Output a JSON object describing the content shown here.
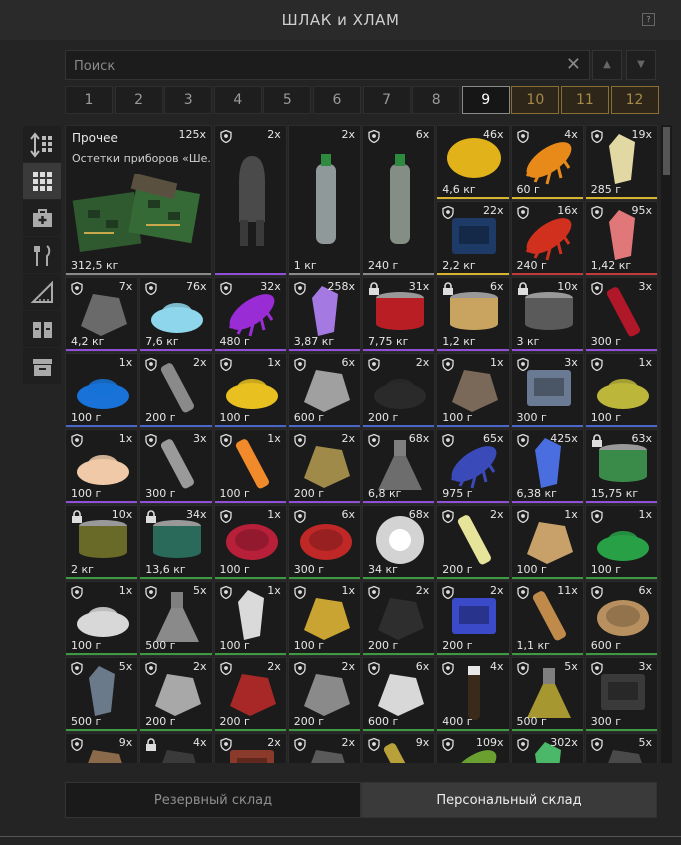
{
  "window": {
    "title": "ШЛАК и ХЛАМ",
    "help": "?"
  },
  "search": {
    "placeholder": "Поиск",
    "value": ""
  },
  "pages": [
    {
      "label": "1",
      "state": "normal"
    },
    {
      "label": "2",
      "state": "normal"
    },
    {
      "label": "3",
      "state": "normal"
    },
    {
      "label": "4",
      "state": "normal"
    },
    {
      "label": "5",
      "state": "normal"
    },
    {
      "label": "6",
      "state": "normal"
    },
    {
      "label": "7",
      "state": "normal"
    },
    {
      "label": "8",
      "state": "normal"
    },
    {
      "label": "9",
      "state": "active"
    },
    {
      "label": "10",
      "state": "locked"
    },
    {
      "label": "11",
      "state": "locked"
    },
    {
      "label": "12",
      "state": "locked"
    }
  ],
  "sidebar": [
    {
      "icon": "sort-icon",
      "active": false
    },
    {
      "icon": "grid-icon",
      "active": true
    },
    {
      "icon": "medkit-icon",
      "active": false
    },
    {
      "icon": "cutlery-icon",
      "active": false
    },
    {
      "icon": "ruler-icon",
      "active": false
    },
    {
      "icon": "book-icon",
      "active": false
    },
    {
      "icon": "archive-icon",
      "active": false
    }
  ],
  "featured": {
    "name": "Прочее",
    "desc": "Остетки приборов «Ше...",
    "count": "125x",
    "weight": "312,5 кг"
  },
  "colors": {
    "grey": "#8a8a8a",
    "blue": "#4a66c8",
    "purple": "#8f4fd8",
    "red": "#c23a3a",
    "yellow": "#d8b530",
    "green": "#3d9a40",
    "none": "#2c2c2c"
  },
  "items": [
    {
      "r": 0,
      "c": 2,
      "rs": 2,
      "cnt": "2x",
      "wt": "",
      "sh": "shield",
      "bar": "purple",
      "icon": "bomb-icon",
      "col": "#4a4a4a"
    },
    {
      "r": 0,
      "c": 3,
      "rs": 2,
      "cnt": "2x",
      "wt": "1 кг",
      "sh": "",
      "bar": "grey",
      "icon": "water-bottle-icon",
      "col": "#b8c4c4"
    },
    {
      "r": 0,
      "c": 4,
      "rs": 2,
      "cnt": "6x",
      "wt": "240 г",
      "sh": "shield",
      "bar": "grey",
      "icon": "water-bottle-icon",
      "col": "#a9b6aa"
    },
    {
      "r": 0,
      "c": 5,
      "cnt": "46x",
      "wt": "4,6 кг",
      "sh": "",
      "bar": "yellow",
      "icon": "lemon-icon",
      "col": "#e1b21a"
    },
    {
      "r": 0,
      "c": 6,
      "cnt": "4x",
      "wt": "60 г",
      "sh": "shield",
      "bar": "yellow",
      "icon": "spiky-orange-icon",
      "col": "#e88a1a"
    },
    {
      "r": 0,
      "c": 7,
      "cnt": "19x",
      "wt": "285 г",
      "sh": "shield",
      "bar": "yellow",
      "icon": "pale-crystal-icon",
      "col": "#e2d8a4"
    },
    {
      "r": 1,
      "c": 5,
      "cnt": "22x",
      "wt": "2,2 кг",
      "sh": "shield",
      "bar": "yellow",
      "icon": "manual-book-icon",
      "col": "#1e3a66"
    },
    {
      "r": 1,
      "c": 6,
      "cnt": "16x",
      "wt": "240 г",
      "sh": "shield",
      "bar": "red",
      "icon": "spiky-red-icon",
      "col": "#d2301e"
    },
    {
      "r": 1,
      "c": 7,
      "cnt": "95x",
      "wt": "1,42 кг",
      "sh": "shield",
      "bar": "red",
      "icon": "pink-crystal-icon",
      "col": "#e0787a"
    },
    {
      "r": 2,
      "c": 0,
      "cnt": "7x",
      "wt": "4,2 кг",
      "sh": "shield",
      "bar": "purple",
      "icon": "metal-scrap-icon",
      "col": "#6a6a6a"
    },
    {
      "r": 2,
      "c": 1,
      "cnt": "76x",
      "wt": "7,6 кг",
      "sh": "shield",
      "bar": "purple",
      "icon": "blue-powder-icon",
      "col": "#8ed6ec"
    },
    {
      "r": 2,
      "c": 2,
      "cnt": "32x",
      "wt": "480 г",
      "sh": "shield",
      "bar": "purple",
      "icon": "spiky-purple-icon",
      "col": "#9a2cd6"
    },
    {
      "r": 2,
      "c": 3,
      "cnt": "258x",
      "wt": "3,87 кг",
      "sh": "shield",
      "bar": "purple",
      "icon": "purple-crystal-icon",
      "col": "#a47ae2"
    },
    {
      "r": 2,
      "c": 4,
      "cnt": "31x",
      "wt": "7,75 кг",
      "sh": "lock",
      "bar": "purple",
      "icon": "red-can-icon",
      "col": "#b81e24"
    },
    {
      "r": 2,
      "c": 5,
      "cnt": "6x",
      "wt": "1,2 кг",
      "sh": "lock",
      "bar": "purple",
      "icon": "tin-can-icon",
      "col": "#c8a460"
    },
    {
      "r": 2,
      "c": 6,
      "cnt": "10x",
      "wt": "3 кг",
      "sh": "lock",
      "bar": "purple",
      "icon": "grey-can-icon",
      "col": "#5a5a5a"
    },
    {
      "r": 2,
      "c": 7,
      "cnt": "3x",
      "wt": "300 г",
      "sh": "shield",
      "bar": "purple",
      "icon": "red-tube-icon",
      "col": "#b0182a"
    },
    {
      "r": 3,
      "c": 0,
      "cnt": "1x",
      "wt": "100 г",
      "sh": "",
      "bar": "blue",
      "icon": "blue-granules-icon",
      "col": "#1872d8"
    },
    {
      "r": 3,
      "c": 1,
      "cnt": "2x",
      "wt": "200 г",
      "sh": "shield",
      "bar": "blue",
      "icon": "metal-bar-icon",
      "col": "#8a8a8a"
    },
    {
      "r": 3,
      "c": 2,
      "cnt": "1x",
      "wt": "100 г",
      "sh": "shield",
      "bar": "blue",
      "icon": "yellow-granules-icon",
      "col": "#e8c020"
    },
    {
      "r": 3,
      "c": 3,
      "cnt": "6x",
      "wt": "600 г",
      "sh": "shield",
      "bar": "blue",
      "icon": "metal-part-icon",
      "col": "#a0a0a0"
    },
    {
      "r": 3,
      "c": 4,
      "cnt": "2x",
      "wt": "200 г",
      "sh": "shield",
      "bar": "blue",
      "icon": "black-granules-icon",
      "col": "#2a2a2a"
    },
    {
      "r": 3,
      "c": 5,
      "cnt": "1x",
      "wt": "100 г",
      "sh": "shield",
      "bar": "blue",
      "icon": "cloth-icon",
      "col": "#7a6858"
    },
    {
      "r": 3,
      "c": 6,
      "cnt": "3x",
      "wt": "300 г",
      "sh": "shield",
      "bar": "blue",
      "icon": "tool-case-icon",
      "col": "#6a7a92"
    },
    {
      "r": 3,
      "c": 7,
      "cnt": "1x",
      "wt": "100 г",
      "sh": "shield",
      "bar": "blue",
      "icon": "olive-granules-icon",
      "col": "#bcb63a"
    },
    {
      "r": 4,
      "c": 0,
      "cnt": "1x",
      "wt": "100 г",
      "sh": "shield",
      "bar": "purple",
      "icon": "beige-granules-icon",
      "col": "#f0caa8"
    },
    {
      "r": 4,
      "c": 1,
      "cnt": "3x",
      "wt": "300 г",
      "sh": "shield",
      "bar": "purple",
      "icon": "syringe-icon",
      "col": "#9a9a9a"
    },
    {
      "r": 4,
      "c": 2,
      "cnt": "1x",
      "wt": "100 г",
      "sh": "shield",
      "bar": "purple",
      "icon": "orange-tube-icon",
      "col": "#f08a2a"
    },
    {
      "r": 4,
      "c": 3,
      "cnt": "2x",
      "wt": "200 г",
      "sh": "shield",
      "bar": "purple",
      "icon": "engine-icon",
      "col": "#a08a4a"
    },
    {
      "r": 4,
      "c": 4,
      "cnt": "68x",
      "wt": "6,8 кг",
      "sh": "shield",
      "bar": "purple",
      "icon": "flask-icon",
      "col": "#8a8a8a"
    },
    {
      "r": 4,
      "c": 5,
      "cnt": "65x",
      "wt": "975 г",
      "sh": "shield",
      "bar": "purple",
      "icon": "spiky-blue-icon",
      "col": "#3a4ab8"
    },
    {
      "r": 4,
      "c": 6,
      "cnt": "425x",
      "wt": "6,38 кг",
      "sh": "shield",
      "bar": "purple",
      "icon": "blue-crystal-icon",
      "col": "#4a6ee0"
    },
    {
      "r": 4,
      "c": 7,
      "cnt": "63x",
      "wt": "15,75 кг",
      "sh": "lock",
      "bar": "purple",
      "icon": "green-can-icon",
      "col": "#3a8a4a"
    },
    {
      "r": 5,
      "c": 0,
      "cnt": "10x",
      "wt": "2 кг",
      "sh": "lock",
      "bar": "green",
      "icon": "olive-can-icon",
      "col": "#6a6a28"
    },
    {
      "r": 5,
      "c": 1,
      "cnt": "34x",
      "wt": "13,6 кг",
      "sh": "lock",
      "bar": "green",
      "icon": "green-label-can-icon",
      "col": "#2a6a5a"
    },
    {
      "r": 5,
      "c": 2,
      "cnt": "1x",
      "wt": "100 г",
      "sh": "shield",
      "bar": "green",
      "icon": "meat-icon",
      "col": "#b8203a"
    },
    {
      "r": 5,
      "c": 3,
      "cnt": "6x",
      "wt": "300 г",
      "sh": "shield",
      "bar": "green",
      "icon": "salami-icon",
      "col": "#c02828"
    },
    {
      "r": 5,
      "c": 4,
      "cnt": "68x",
      "wt": "34 кг",
      "sh": "",
      "bar": "green",
      "icon": "glowing-orb-icon",
      "col": "#e8e8e8"
    },
    {
      "r": 5,
      "c": 5,
      "cnt": "2x",
      "wt": "200 г",
      "sh": "shield",
      "bar": "green",
      "icon": "yellow-stick-icon",
      "col": "#e6e49a"
    },
    {
      "r": 5,
      "c": 6,
      "cnt": "1x",
      "wt": "100 г",
      "sh": "shield",
      "bar": "green",
      "icon": "cutting-board-icon",
      "col": "#c8a06a"
    },
    {
      "r": 5,
      "c": 7,
      "cnt": "1x",
      "wt": "100 г",
      "sh": "shield",
      "bar": "green",
      "icon": "green-granules-icon",
      "col": "#28a046"
    },
    {
      "r": 6,
      "c": 0,
      "cnt": "1x",
      "wt": "100 г",
      "sh": "shield",
      "bar": "green",
      "icon": "white-powder-icon",
      "col": "#d8d8d8"
    },
    {
      "r": 6,
      "c": 1,
      "cnt": "5x",
      "wt": "500 г",
      "sh": "shield",
      "bar": "green",
      "icon": "flask-icon",
      "col": "#b0b0b0"
    },
    {
      "r": 6,
      "c": 2,
      "cnt": "1x",
      "wt": "100 г",
      "sh": "shield",
      "bar": "green",
      "icon": "white-crystal-icon",
      "col": "#dadada"
    },
    {
      "r": 6,
      "c": 3,
      "cnt": "1x",
      "wt": "100 г",
      "sh": "shield",
      "bar": "green",
      "icon": "yellow-cubes-icon",
      "col": "#caa432"
    },
    {
      "r": 6,
      "c": 4,
      "cnt": "2x",
      "wt": "200 г",
      "sh": "shield",
      "bar": "green",
      "icon": "dark-rock-icon",
      "col": "#2e2e2e"
    },
    {
      "r": 6,
      "c": 5,
      "cnt": "2x",
      "wt": "200 г",
      "sh": "shield",
      "bar": "green",
      "icon": "blue-box-icon",
      "col": "#3a4ac8"
    },
    {
      "r": 6,
      "c": 6,
      "cnt": "11x",
      "wt": "1,1 кг",
      "sh": "shield",
      "bar": "green",
      "icon": "wood-plank-icon",
      "col": "#c08a4a"
    },
    {
      "r": 6,
      "c": 7,
      "cnt": "6x",
      "wt": "600 г",
      "sh": "shield",
      "bar": "green",
      "icon": "bowl-icon",
      "col": "#b89060"
    },
    {
      "r": 7,
      "c": 0,
      "cnt": "5x",
      "wt": "500 г",
      "sh": "shield",
      "bar": "green",
      "icon": "grey-crystal-icon",
      "col": "#6a7a8a"
    },
    {
      "r": 7,
      "c": 1,
      "cnt": "2x",
      "wt": "200 г",
      "sh": "shield",
      "bar": "green",
      "icon": "silver-ore-icon",
      "col": "#a8a8a8"
    },
    {
      "r": 7,
      "c": 2,
      "cnt": "2x",
      "wt": "200 г",
      "sh": "shield",
      "bar": "green",
      "icon": "red-berries-icon",
      "col": "#a82828"
    },
    {
      "r": 7,
      "c": 3,
      "cnt": "2x",
      "wt": "200 г",
      "sh": "shield",
      "bar": "green",
      "icon": "grey-rock-icon",
      "col": "#8a8a8a"
    },
    {
      "r": 7,
      "c": 4,
      "cnt": "6x",
      "wt": "600 г",
      "sh": "shield",
      "bar": "green",
      "icon": "white-cloth-icon",
      "col": "#d8d8d8"
    },
    {
      "r": 7,
      "c": 5,
      "cnt": "4x",
      "wt": "400 г",
      "sh": "shield",
      "bar": "green",
      "icon": "vial-icon",
      "col": "#3a2a1a"
    },
    {
      "r": 7,
      "c": 6,
      "cnt": "5x",
      "wt": "500 г",
      "sh": "shield",
      "bar": "green",
      "icon": "yellow-flask-icon",
      "col": "#d6c23a"
    },
    {
      "r": 7,
      "c": 7,
      "cnt": "3x",
      "wt": "300 г",
      "sh": "shield",
      "bar": "green",
      "icon": "first-aid-case-icon",
      "col": "#3a3a3a"
    },
    {
      "r": 8,
      "c": 0,
      "cnt": "9x",
      "wt": "",
      "sh": "shield",
      "bar": "none",
      "icon": "brown-item-icon",
      "col": "#8a6a4a"
    },
    {
      "r": 8,
      "c": 1,
      "cnt": "4x",
      "wt": "",
      "sh": "lock",
      "bar": "none",
      "icon": "dark-item-icon",
      "col": "#3a3a3a"
    },
    {
      "r": 8,
      "c": 2,
      "cnt": "2x",
      "wt": "",
      "sh": "shield",
      "bar": "none",
      "icon": "box-item-icon",
      "col": "#8a3a2a"
    },
    {
      "r": 8,
      "c": 3,
      "cnt": "2x",
      "wt": "",
      "sh": "shield",
      "bar": "none",
      "icon": "grey-item-icon",
      "col": "#5a5a5a"
    },
    {
      "r": 8,
      "c": 4,
      "cnt": "9x",
      "wt": "",
      "sh": "shield",
      "bar": "none",
      "icon": "stick-item-icon",
      "col": "#b8a03a"
    },
    {
      "r": 8,
      "c": 5,
      "cnt": "109x",
      "wt": "",
      "sh": "shield",
      "bar": "none",
      "icon": "green-spiky-icon",
      "col": "#6aa030"
    },
    {
      "r": 8,
      "c": 6,
      "cnt": "302x",
      "wt": "",
      "sh": "shield",
      "bar": "none",
      "icon": "green-crystal-icon",
      "col": "#4ab868"
    },
    {
      "r": 8,
      "c": 7,
      "cnt": "5x",
      "wt": "",
      "sh": "shield",
      "bar": "none",
      "icon": "dark-item-icon",
      "col": "#4a4a4a"
    }
  ],
  "bottom_tabs": [
    {
      "label": "Резервный склад",
      "active": false
    },
    {
      "label": "Персональный склад",
      "active": true
    }
  ]
}
